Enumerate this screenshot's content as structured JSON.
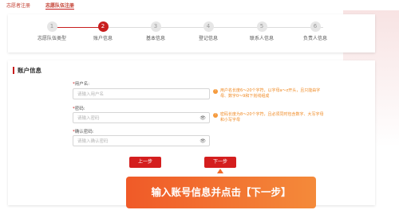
{
  "top_tabs": [
    {
      "label": "志愿者注册"
    },
    {
      "label": "志愿队伍注册"
    }
  ],
  "steps": [
    {
      "num": "1",
      "label": "志愿队伍类型"
    },
    {
      "num": "2",
      "label": "账户信息"
    },
    {
      "num": "3",
      "label": "基本信息"
    },
    {
      "num": "4",
      "label": "登记信息"
    },
    {
      "num": "5",
      "label": "联系人信息"
    },
    {
      "num": "6",
      "label": "负责人信息"
    }
  ],
  "form": {
    "section_title": "账户信息",
    "username": {
      "label": "用户名:",
      "placeholder": "请输入用户名"
    },
    "password": {
      "label": "密码:",
      "placeholder": "请输入密码"
    },
    "confirm": {
      "label": "确认密码:",
      "placeholder": "请输入确认密码"
    },
    "tip_username": "用户名长度6～20个字符，以字母a～z开头，且只能由字母、数字0～9和下划线组成",
    "tip_password": "密码长度为8～20个字符，且必须同时包含数字、大写字母和小写字母",
    "prev_label": "上一步",
    "next_label": "下一步"
  },
  "banner": "输入账号信息并点击【下一步】",
  "colors": {
    "primary": "#c81d1d",
    "tip": "#f08a24",
    "banner": "#f26b2a"
  }
}
